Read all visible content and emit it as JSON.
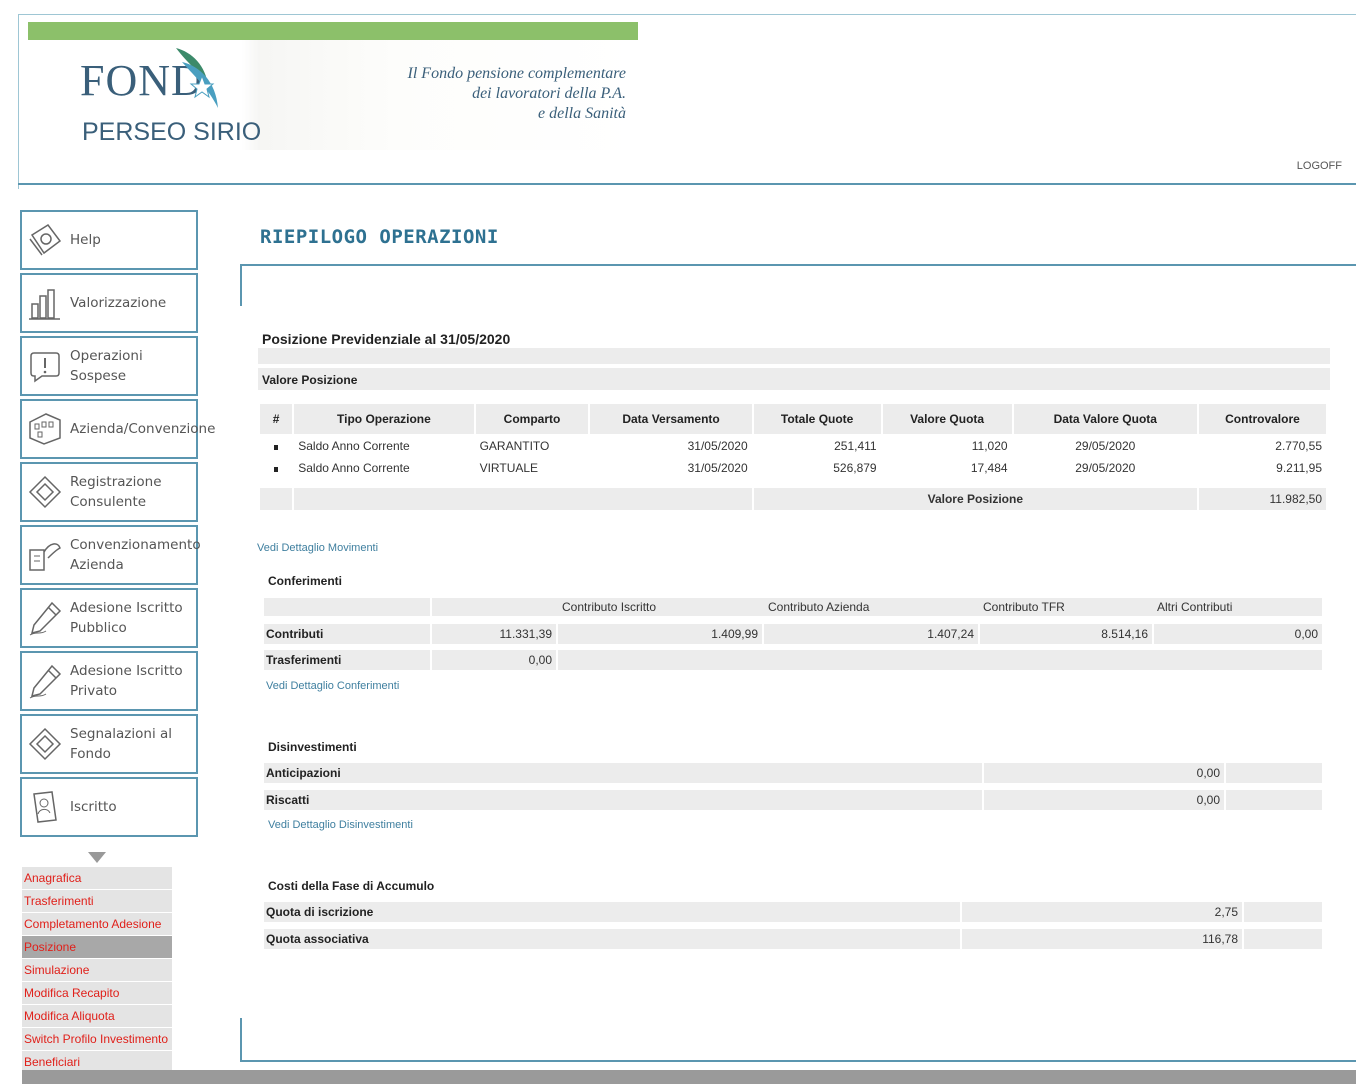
{
  "header": {
    "logo_main": "FOND",
    "logo_sub": "PERSEO SIRIO",
    "tagline": [
      "Il Fondo pensione complementare",
      "dei lavoratori della P.A.",
      "e della Sanità"
    ],
    "logoff": "LOGOFF"
  },
  "sidebar": {
    "items": [
      {
        "label": "Help",
        "icon": "help-book-icon"
      },
      {
        "label": "Valorizzazione",
        "icon": "bar-chart-icon"
      },
      {
        "label": "Operazioni Sospese",
        "icon": "alert-icon"
      },
      {
        "label": "Azienda/Convenzione",
        "icon": "building-icon"
      },
      {
        "label": "Registrazione\nConsulente",
        "icon": "diamond-icon"
      },
      {
        "label": "Convenzionamento\nAzienda",
        "icon": "agreement-icon"
      },
      {
        "label": "Adesione Iscritto\nPubblico",
        "icon": "pen-icon"
      },
      {
        "label": "Adesione Iscritto\nPrivato",
        "icon": "pen-icon"
      },
      {
        "label": "Segnalazioni al\nFondo",
        "icon": "diamond-icon"
      },
      {
        "label": "Iscritto",
        "icon": "document-icon"
      }
    ],
    "submenu": [
      {
        "label": "Anagrafica",
        "active": false
      },
      {
        "label": "Trasferimenti",
        "active": false
      },
      {
        "label": "Completamento Adesione",
        "active": false
      },
      {
        "label": "Posizione",
        "active": true
      },
      {
        "label": "Simulazione",
        "active": false
      },
      {
        "label": "Modifica Recapito",
        "active": false
      },
      {
        "label": "Modifica Aliquota",
        "active": false
      },
      {
        "label": "Switch Profilo Investimento",
        "active": false
      },
      {
        "label": "Beneficiari",
        "active": false
      }
    ]
  },
  "main": {
    "title": "RIEPILOGO OPERAZIONI",
    "posizione_title": "Posizione Previdenziale al 31/05/2020",
    "valore_posizione_heading": "Valore Posizione",
    "ops_table": {
      "headers": [
        "#",
        "Tipo Operazione",
        "Comparto",
        "Data Versamento",
        "Totale Quote",
        "Valore Quota",
        "Data Valore Quota",
        "Controvalore"
      ],
      "rows": [
        [
          "",
          "Saldo Anno Corrente",
          "GARANTITO",
          "31/05/2020",
          "251,411",
          "11,020",
          "29/05/2020",
          "2.770,55"
        ],
        [
          "",
          "Saldo Anno Corrente",
          "VIRTUALE",
          "31/05/2020",
          "526,879",
          "17,484",
          "29/05/2020",
          "9.211,95"
        ]
      ],
      "total_label": "Valore Posizione",
      "total_value": "11.982,50"
    },
    "link_movimenti": "Vedi Dettaglio Movimenti",
    "conferimenti": {
      "title": "Conferimenti",
      "headers": [
        "Contributo Iscritto",
        "Contributo Azienda",
        "Contributo TFR",
        "Altri Contributi"
      ],
      "contributi_label": "Contributi",
      "contributi_values": [
        "11.331,39",
        "1.409,99",
        "1.407,24",
        "8.514,16",
        "0,00"
      ],
      "trasferimenti_label": "Trasferimenti",
      "trasferimenti_value": "0,00",
      "link": "Vedi Dettaglio Conferimenti"
    },
    "disinvestimenti": {
      "title": "Disinvestimenti",
      "anticipazioni_label": "Anticipazioni",
      "anticipazioni_value": "0,00",
      "riscatti_label": "Riscatti",
      "riscatti_value": "0,00",
      "link": "Vedi Dettaglio Disinvestimenti"
    },
    "costi": {
      "title": "Costi della Fase di Accumulo",
      "iscrizione_label": "Quota di iscrizione",
      "iscrizione_value": "2,75",
      "associativa_label": "Quota associativa",
      "associativa_value": "116,78"
    }
  }
}
